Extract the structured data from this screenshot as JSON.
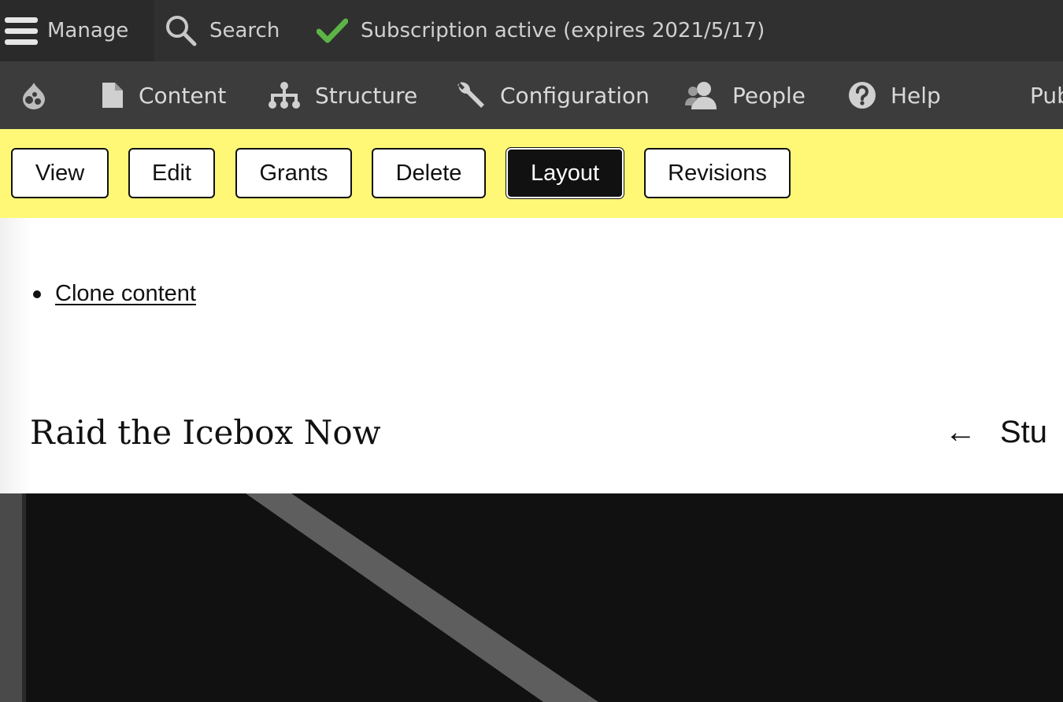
{
  "toolbar": {
    "manage_label": "Manage",
    "search_label": "Search",
    "subscription_label": "Subscription active (expires 2021/5/17)",
    "subscription_color": "#5cb446"
  },
  "nav": {
    "home_icon": "drupal-drop-icon",
    "items": [
      {
        "label": "Content",
        "icon": "file-icon"
      },
      {
        "label": "Structure",
        "icon": "sitemap-icon"
      },
      {
        "label": "Configuration",
        "icon": "wrench-icon"
      },
      {
        "label": "People",
        "icon": "person-icon"
      },
      {
        "label": "Help",
        "icon": "question-icon"
      },
      {
        "label": "Pub",
        "icon": ""
      }
    ]
  },
  "tabs": [
    {
      "label": "View",
      "active": false
    },
    {
      "label": "Edit",
      "active": false
    },
    {
      "label": "Grants",
      "active": false
    },
    {
      "label": "Delete",
      "active": false
    },
    {
      "label": "Layout",
      "active": true
    },
    {
      "label": "Revisions",
      "active": false
    }
  ],
  "main": {
    "clone_link": "Clone content",
    "page_title": "Raid the Icebox Now",
    "prev_arrow": "←",
    "prev_label": "Stu"
  },
  "colors": {
    "toolbar_bg": "#303030",
    "nav_bg": "#3c3c3c",
    "tabs_bg": "#fff877",
    "hero_bg": "#111111"
  }
}
